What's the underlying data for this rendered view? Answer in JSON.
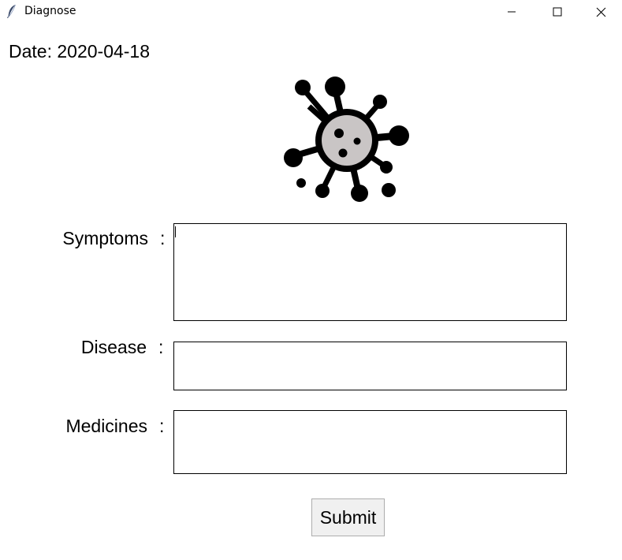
{
  "window": {
    "title": "Diagnose",
    "app_icon": "feather-icon",
    "controls": {
      "minimize_icon": "minimize-icon",
      "maximize_icon": "maximize-icon",
      "close_icon": "close-icon"
    }
  },
  "header": {
    "date_text": "Date: 2020-04-18"
  },
  "logo": {
    "icon": "virus-icon",
    "colors": {
      "body": "#000000",
      "core": "#c9c5c5"
    }
  },
  "form": {
    "symptoms": {
      "label": "Symptoms",
      "colon": ":",
      "value": ""
    },
    "disease": {
      "label": "Disease",
      "colon": ":",
      "value": ""
    },
    "medicines": {
      "label": "Medicines",
      "colon": ":",
      "value": ""
    },
    "submit_label": "Submit"
  }
}
